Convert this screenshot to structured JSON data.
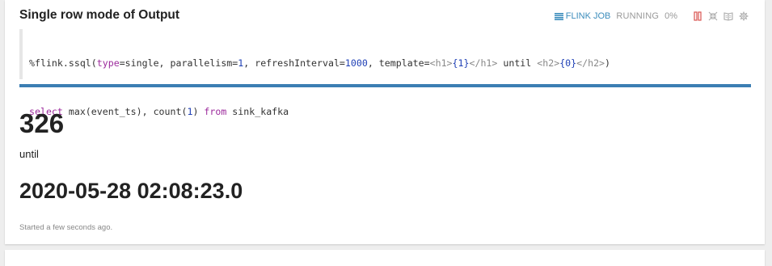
{
  "paragraph": {
    "title": "Single row mode of Output",
    "job_link_label": "FLINK JOB",
    "status": "RUNNING",
    "progress": "0%",
    "icons": [
      "flink-job-icon",
      "pause-icon",
      "collapse-icon",
      "book-icon",
      "gear-icon"
    ]
  },
  "code": {
    "line1": {
      "prefix": "%flink.ssql(",
      "k_type": "type",
      "eq1": "=single, parallelism=",
      "n1": "1",
      "mid1": ", refreshInterval=",
      "n2": "1000",
      "mid2": ", template=",
      "t1": "<h1>",
      "b1": "{1}",
      "t2": "</h1>",
      "until": " until ",
      "t3": "<h2>",
      "b2": "{0}",
      "t4": "</h2>",
      "suffix": ")"
    },
    "line2": {
      "kw1": "select",
      "mid": " max(event_ts), count(",
      "n": "1",
      "close": ") ",
      "kw2": "from",
      "rest": " sink_kafka"
    }
  },
  "result": {
    "h1": "326",
    "separator": "until",
    "h2": "2020-05-28 02:08:23.0"
  },
  "footer": {
    "text": "Started a few seconds ago."
  },
  "colors": {
    "accent": "#3c8dbc",
    "progress_bar": "#3c7eb3",
    "keyword": "#9c2a9c",
    "number": "#1e3fb5",
    "pause": "#d9534f"
  }
}
